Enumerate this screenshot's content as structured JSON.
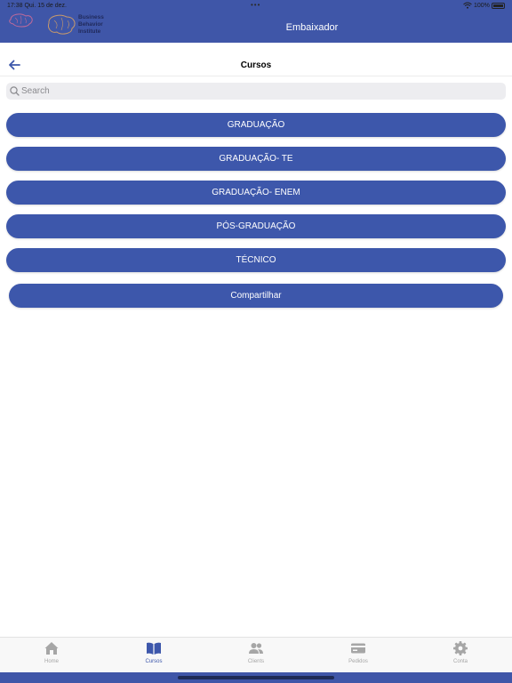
{
  "status_bar": {
    "time_date": "17:38  Qui. 15 de dez.",
    "dots": "•••",
    "battery": "100%"
  },
  "brand": {
    "line1": "Business",
    "line2": "Behavior",
    "line3": "Institute"
  },
  "header": {
    "title": "Embaixador"
  },
  "nav": {
    "title": "Cursos"
  },
  "search": {
    "placeholder": "Search",
    "value": ""
  },
  "courses": [
    {
      "label": "GRADUAÇÃO"
    },
    {
      "label": "GRADUAÇÃO- TE"
    },
    {
      "label": "GRADUAÇÃO- ENEM"
    },
    {
      "label": "PÓS-GRADUAÇÃO"
    },
    {
      "label": "TÉCNICO"
    }
  ],
  "share_button": "Compartilhar",
  "tabs": [
    {
      "label": "Home",
      "icon": "home-icon"
    },
    {
      "label": "Cursos",
      "icon": "book-icon",
      "active": true
    },
    {
      "label": "Clients",
      "icon": "users-icon"
    },
    {
      "label": "Pedidos",
      "icon": "card-icon"
    },
    {
      "label": "Conta",
      "icon": "gear-icon"
    }
  ],
  "colors": {
    "primary": "#3d57ab",
    "header": "#3f56a8",
    "inactive_tab": "#a6a6a6"
  }
}
